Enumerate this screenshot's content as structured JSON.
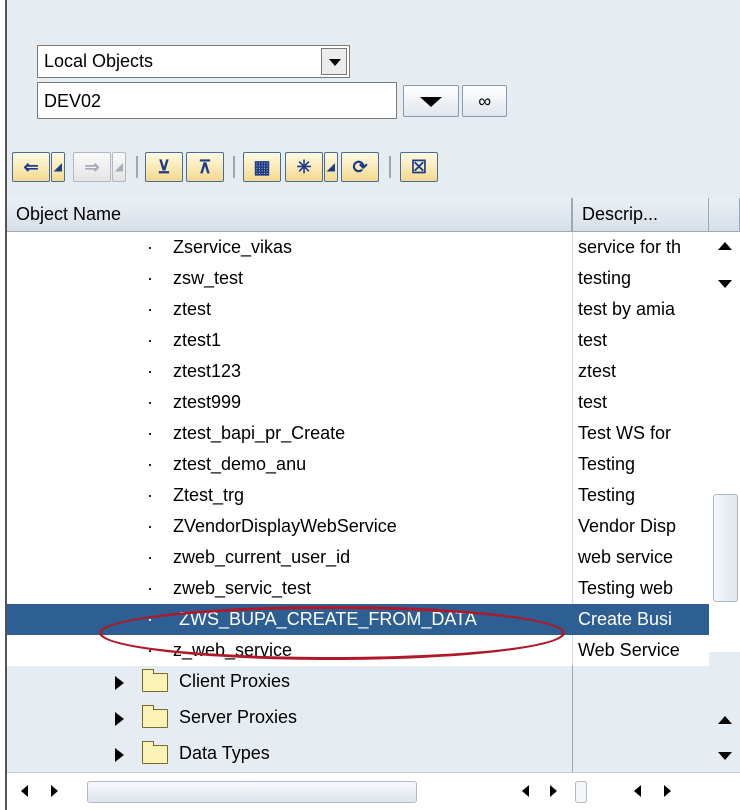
{
  "selector": {
    "value": "Local Objects"
  },
  "package_field": {
    "value": "DEV02"
  },
  "toolbar": {
    "back_icon": "arrow-left-icon",
    "forward_icon": "arrow-right-icon",
    "expand_icon": "expand-icon",
    "collapse_icon": "collapse-icon",
    "hierarchy_icon": "hierarchy-icon",
    "star_icon": "star-icon",
    "refresh_icon": "refresh-icon",
    "close_icon": "close-icon"
  },
  "columns": {
    "name": "Object Name",
    "description": "Descrip..."
  },
  "rows": [
    {
      "name": "Zservice_vikas",
      "desc": "service for th"
    },
    {
      "name": "zsw_test",
      "desc": "testing"
    },
    {
      "name": "ztest",
      "desc": "test by amia"
    },
    {
      "name": "ztest1",
      "desc": "test"
    },
    {
      "name": "ztest123",
      "desc": "ztest"
    },
    {
      "name": "ztest999",
      "desc": "test"
    },
    {
      "name": "ztest_bapi_pr_Create",
      "desc": "Test WS for"
    },
    {
      "name": "ztest_demo_anu",
      "desc": "Testing"
    },
    {
      "name": "Ztest_trg",
      "desc": "Testing"
    },
    {
      "name": "ZVendorDisplayWebService",
      "desc": "Vendor Disp"
    },
    {
      "name": "zweb_current_user_id",
      "desc": "web service"
    },
    {
      "name": "zweb_servic_test",
      "desc": "Testing web"
    },
    {
      "name": "ZWS_BUPA_CREATE_FROM_DATA",
      "desc": "Create Busi"
    },
    {
      "name": "z_web_service",
      "desc": "Web Service"
    }
  ],
  "folders": [
    {
      "label": "Client Proxies"
    },
    {
      "label": "Server Proxies"
    },
    {
      "label": "Data Types"
    }
  ],
  "colors": {
    "selection": "#2d5f93",
    "highlight_ring": "#b01828",
    "panel": "#e6edf2"
  }
}
